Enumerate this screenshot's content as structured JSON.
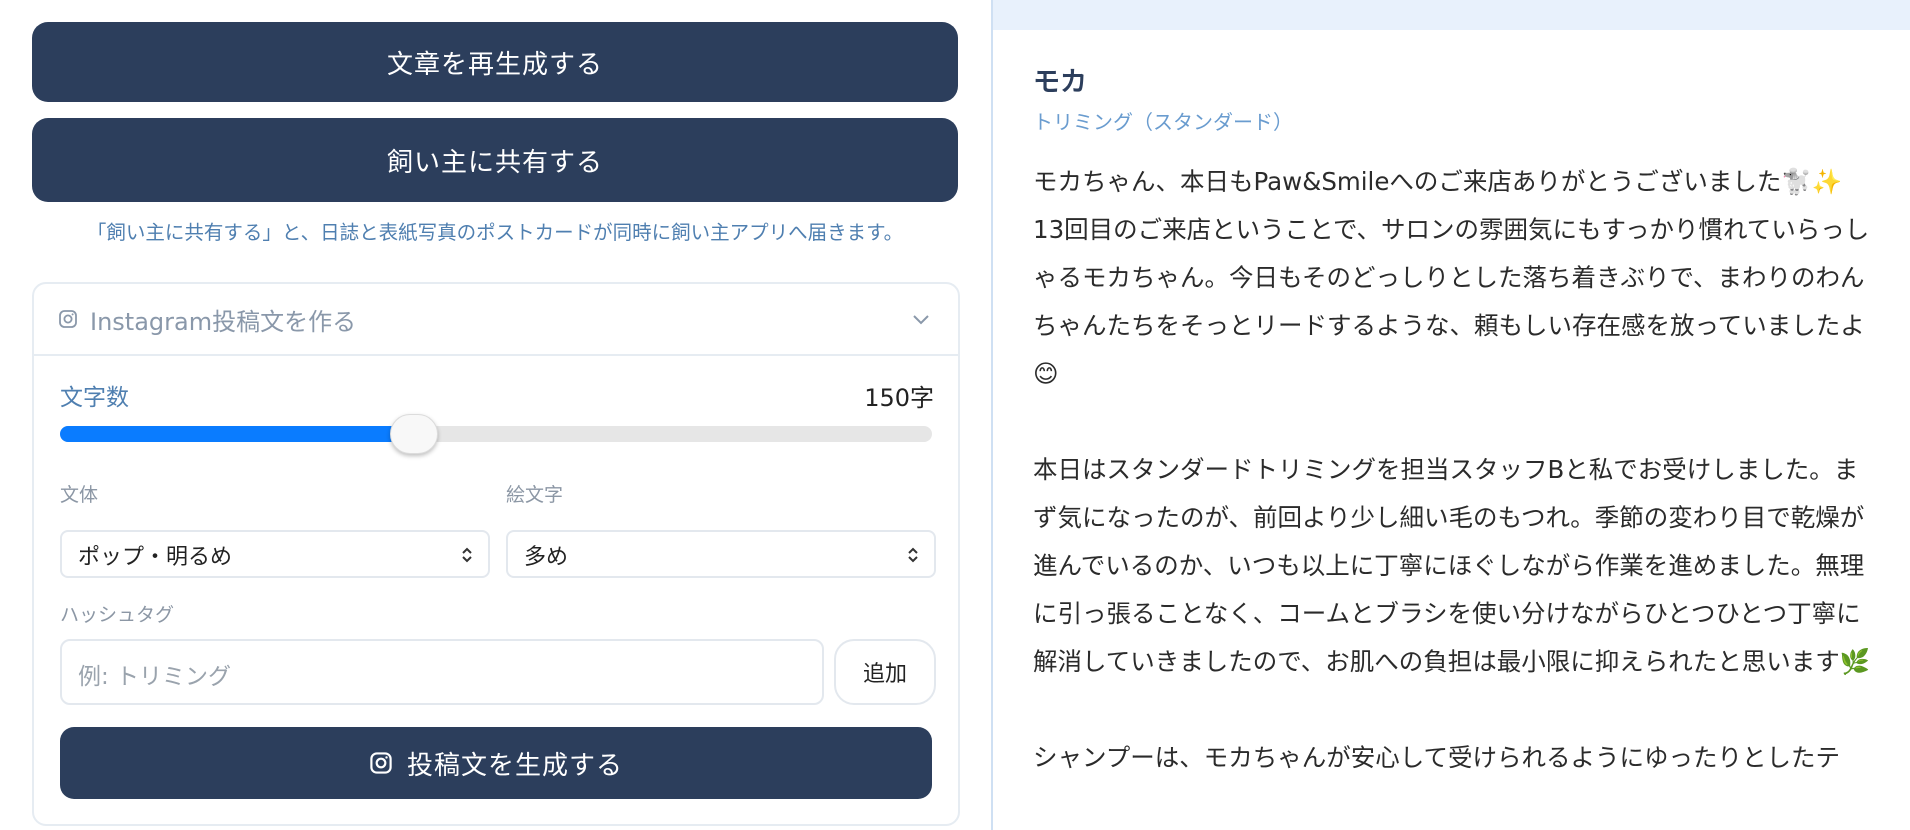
{
  "left": {
    "regenerate_label": "文章を再生成する",
    "share_label": "飼い主に共有する",
    "share_note": "「飼い主に共有する」と、日誌と表紙写真のポストカードが同時に飼い主アプリへ届きます。",
    "instagram": {
      "title": "Instagram投稿文を作る",
      "char_count_label": "文字数",
      "char_count_value": "150字",
      "slider_fraction": 0.405,
      "style_label": "文体",
      "style_value": "ポップ・明るめ",
      "emoji_label": "絵文字",
      "emoji_value": "多め",
      "hashtag_label": "ハッシュタグ",
      "hashtag_placeholder": "例: トリミング",
      "add_label": "追加",
      "generate_label": "投稿文を生成する"
    }
  },
  "right": {
    "pet_name": "モカ",
    "service": "トリミング（スタンダード）",
    "paragraphs": [
      "モカちゃん、本日もPaw&Smileへのご来店ありがとうございました🐩✨ 13回目のご来店ということで、サロンの雰囲気にもすっかり慣れていらっしゃるモカちゃん。今日もそのどっしりとした落ち着きぶりで、まわりのわんちゃんたちをそっとリードするような、頼もしい存在感を放っていましたよ😊",
      "本日はスタンダードトリミングを担当スタッフBと私でお受けしました。まず気になったのが、前回より少し細い毛のもつれ。季節の変わり目で乾燥が進んでいるのか、いつも以上に丁寧にほぐしながら作業を進めました。無理に引っ張ることなく、コームとブラシを使い分けながらひとつひとつ丁寧に解消していきましたので、お肌への負担は最小限に抑えられたと思います🌿",
      "シャンプーは、モカちゃんが安心して受けられるようにゆったりとしたテ"
    ]
  },
  "colors": {
    "primary_button": "#2c3e5c",
    "slider_fill": "#0a7cff",
    "note_text": "#4f7fb0",
    "topband": "#e8f1fc"
  }
}
